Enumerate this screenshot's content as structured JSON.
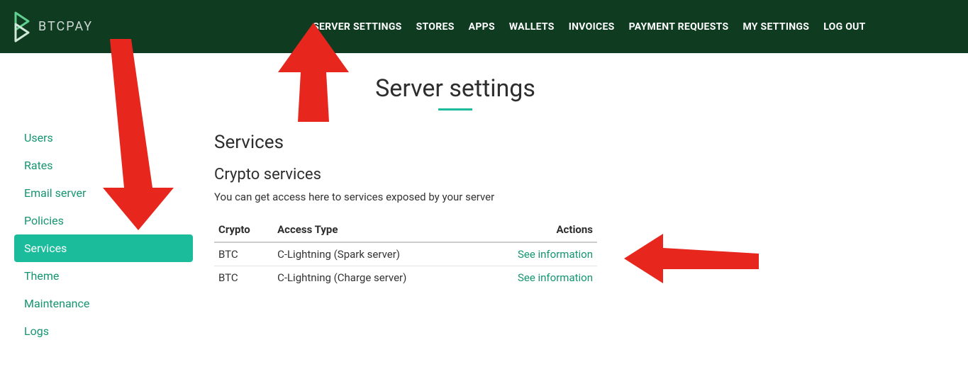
{
  "brand": {
    "name": "BTCPAY"
  },
  "nav": [
    "SERVER SETTINGS",
    "STORES",
    "APPS",
    "WALLETS",
    "INVOICES",
    "PAYMENT REQUESTS",
    "MY SETTINGS",
    "LOG OUT"
  ],
  "sidebar": {
    "items": [
      {
        "label": "Users",
        "active": false
      },
      {
        "label": "Rates",
        "active": false
      },
      {
        "label": "Email server",
        "active": false
      },
      {
        "label": "Policies",
        "active": false
      },
      {
        "label": "Services",
        "active": true
      },
      {
        "label": "Theme",
        "active": false
      },
      {
        "label": "Maintenance",
        "active": false
      },
      {
        "label": "Logs",
        "active": false
      }
    ]
  },
  "page": {
    "title": "Server settings",
    "section": "Services",
    "subsection": "Crypto services",
    "description": "You can get access here to services exposed by your server",
    "table": {
      "headers": [
        "Crypto",
        "Access Type",
        "Actions"
      ],
      "rows": [
        {
          "crypto": "BTC",
          "access_type": "C-Lightning (Spark server)",
          "action": "See information"
        },
        {
          "crypto": "BTC",
          "access_type": "C-Lightning (Charge server)",
          "action": "See information"
        }
      ]
    }
  }
}
